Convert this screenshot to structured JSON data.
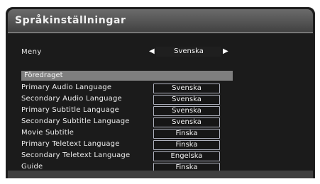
{
  "title": "Språkinställningar",
  "menu": {
    "label": "Meny",
    "value": "Svenska",
    "left_arrow": "◀",
    "right_arrow": "▶"
  },
  "section_header": "Föredraget",
  "rows": [
    {
      "label": "Primary Audio Language",
      "value": "Svenska"
    },
    {
      "label": "Secondary Audio Language",
      "value": "Svenska"
    },
    {
      "label": "Primary Subtitle Language",
      "value": "Svenska"
    },
    {
      "label": "Secondary Subtitle Language",
      "value": "Svenska"
    },
    {
      "label": "Movie Subtitle",
      "value": "Finska"
    },
    {
      "label": "Primary Teletext Language",
      "value": "Finska"
    },
    {
      "label": "Secondary Teletext Language",
      "value": "Engelska"
    },
    {
      "label": "Guide",
      "value": "Finska"
    }
  ]
}
